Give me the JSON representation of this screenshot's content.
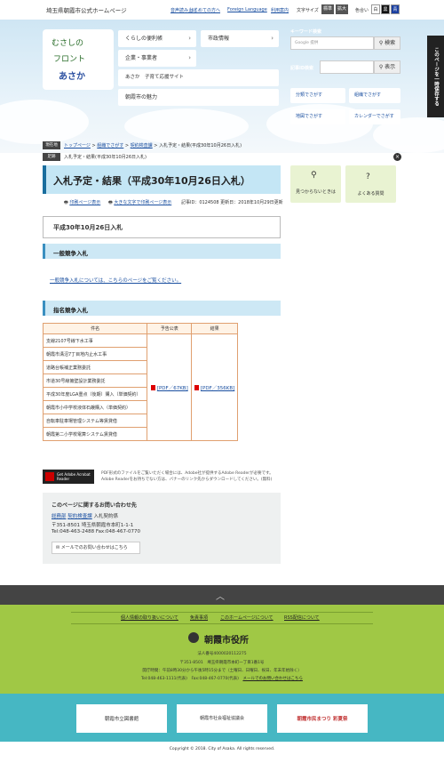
{
  "header": {
    "site_title": "埼玉県朝霞市公式ホームページ",
    "links": [
      "音声読み上げ",
      "はじめての方へ",
      "Foreign Language",
      "利用案内"
    ],
    "font_size_label": "文字サイズ",
    "font_sizes": [
      "標準",
      "拡大"
    ],
    "color_label": "色合い",
    "colors": [
      "白",
      "黒",
      "青"
    ]
  },
  "hero": {
    "logo_text_1": "むさしの",
    "logo_text_2": "フロント",
    "logo_text_3": "あさか",
    "menu": [
      {
        "label": "くらしの便利帳"
      },
      {
        "label": "市政情報"
      },
      {
        "label": "企業・事業者"
      }
    ],
    "banner_1": "あさか　子育て応援サイト",
    "banner_2": "朝霞市の魅力",
    "keyword_search": {
      "heading": "キーワード検索",
      "placeholder": "Google 提供",
      "button": "検索"
    },
    "page_id_search": {
      "heading": "記事ID検索",
      "button": "表示"
    },
    "find_links": [
      "分類でさがす",
      "組織でさがす",
      "地図でさがす",
      "カレンダーでさがす"
    ],
    "vertical_tab": "このページを一時保存する"
  },
  "breadcrumb": {
    "current_badge": "現在地",
    "items": [
      "トップページ",
      "組織でさがす",
      "契約検査課",
      "入札予定・結果(平成30年10月26日入札)"
    ],
    "history_badge": "足跡",
    "history_item": "入札予定・結果(平成30年10月26日入札)"
  },
  "page": {
    "title": "入札予定・結果（平成30年10月26日入札）",
    "print_link": "印刷ページ表示",
    "print_large_link": "大きな文字で印刷ページ表示",
    "meta": "記事ID：0124508 更新日：2018年10月29日更新",
    "section_title": "平成30年10月26日入札",
    "general_heading": "一般競争入札",
    "general_text": "一般競争入札については、こちらのページをご覧ください。",
    "designated_heading": "指名競争入札"
  },
  "quick_links": [
    {
      "label": "見つからないときは"
    },
    {
      "label": "よくある質問"
    }
  ],
  "table": {
    "headers": [
      "件名",
      "予告公表",
      "結果"
    ],
    "rows": [
      "支線2107号線下水工事",
      "朝霞市溝沼7丁目地内止水工事",
      "道路台帳補正業務委託",
      "市道30号線擁壁設計業務委託",
      "平成30年度LGA重点（後期）購入（単価契約）",
      "朝霞市小中学校液体石鹸購入（単価契約）",
      "自転車駐車場管理システム等賃貸借",
      "朝霞第二小学校電算システム賃貸借"
    ],
    "pdf_1": "[PDF／67KB]",
    "pdf_2": "[PDF／356KB]"
  },
  "adobe": {
    "badge": "Get Adobe Acrobat Reader",
    "text": "PDF形式のファイルをご覧いただく場合には、Adobe社が提供するAdobe Readerが必要です。Adobe Readerをお持ちでない方は、バナーのリンク先からダウンロードしてください。(無料)"
  },
  "contact": {
    "heading": "このページに関するお問い合わせ先",
    "dept_1": "総務部",
    "dept_2": "契約検査課",
    "section": "入札契約係",
    "address": "〒351-8501 埼玉県朝霞市本町1-1-1",
    "phone": "Tel:048-463-2488",
    "fax": "Fax:048-467-0770",
    "mail_button": "メールでのお問い合わせはこちら"
  },
  "footer": {
    "links": [
      "個人情報の取り扱いについて",
      "免責事項",
      "このホームページについて",
      "RSS配信について"
    ],
    "city_name": "朝霞市役所",
    "corp_no": "法人番号4000020112275",
    "address": "〒351-8501　埼玉県朝霞市本町一丁目1番1号",
    "hours": "開庁時間：午前8時30分から午後5時15分まで（土曜日、日曜日、祝日、年末年始除く）",
    "tel": "Tel:048-463-1111(代表)　Fax:048-467-0770(代表)",
    "mail_link": "メールでのお問い合わせはこちら",
    "banners": [
      "朝霞市立図書館",
      "朝霞市社会福祉協議会",
      "朝霞市民まつり 彩夏祭"
    ],
    "copyright": "Copyright © 2018. City of Asaka. All rights reserved."
  },
  "colors": {
    "accent": "#1a6e9e",
    "green": "#a0c845",
    "teal": "#46b7c3"
  }
}
